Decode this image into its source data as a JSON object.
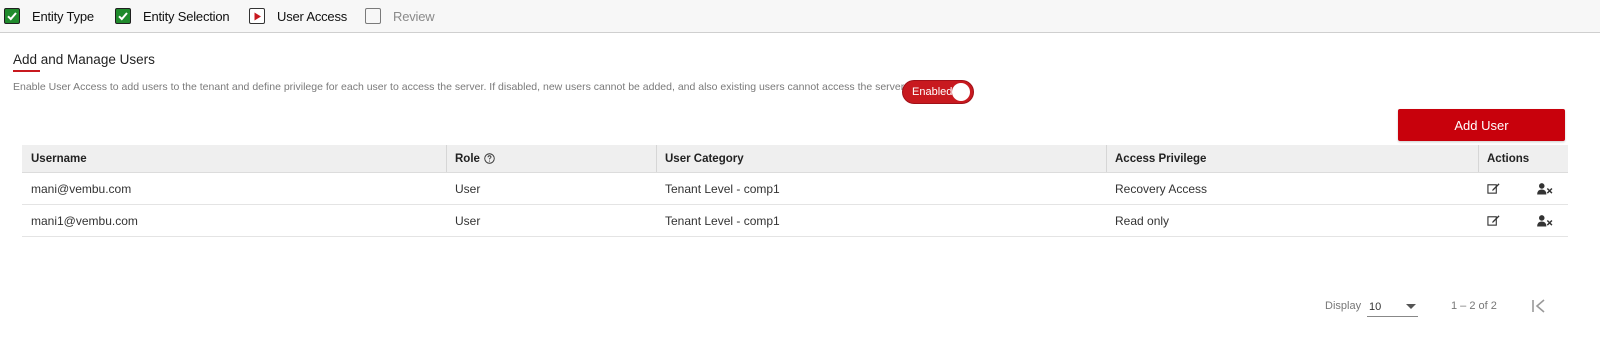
{
  "stepper": {
    "steps": [
      {
        "label": "Entity Type",
        "state": "done"
      },
      {
        "label": "Entity Selection",
        "state": "done"
      },
      {
        "label": "User Access",
        "state": "current"
      },
      {
        "label": "Review",
        "state": "todo"
      }
    ]
  },
  "section": {
    "title": "Add and Manage Users",
    "description": "Enable User Access to add users to the tenant and define privilege for each user to access the server. If disabled, new users cannot be added, and also existing users cannot access the server.",
    "toggle_label": "Enabled",
    "toggle_on": true
  },
  "add_button": {
    "label": "Add User"
  },
  "table": {
    "headers": {
      "username": "Username",
      "role": "Role",
      "user_category": "User Category",
      "access_privilege": "Access Privilege",
      "actions": "Actions"
    },
    "rows": [
      {
        "username": "mani@vembu.com",
        "role": "User",
        "user_category": "Tenant Level - comp1",
        "access_privilege": "Recovery Access"
      },
      {
        "username": "mani1@vembu.com",
        "role": "User",
        "user_category": "Tenant Level - comp1",
        "access_privilege": "Read only"
      }
    ]
  },
  "pagination": {
    "display_label": "Display",
    "page_size": "10",
    "range": "1 – 2 of 2"
  },
  "colors": {
    "accent": "#c8010c",
    "check": "#1f8a2c"
  },
  "icons": [
    "check-icon",
    "play-icon",
    "help-icon",
    "edit-icon",
    "remove-user-icon",
    "first-page-icon"
  ]
}
